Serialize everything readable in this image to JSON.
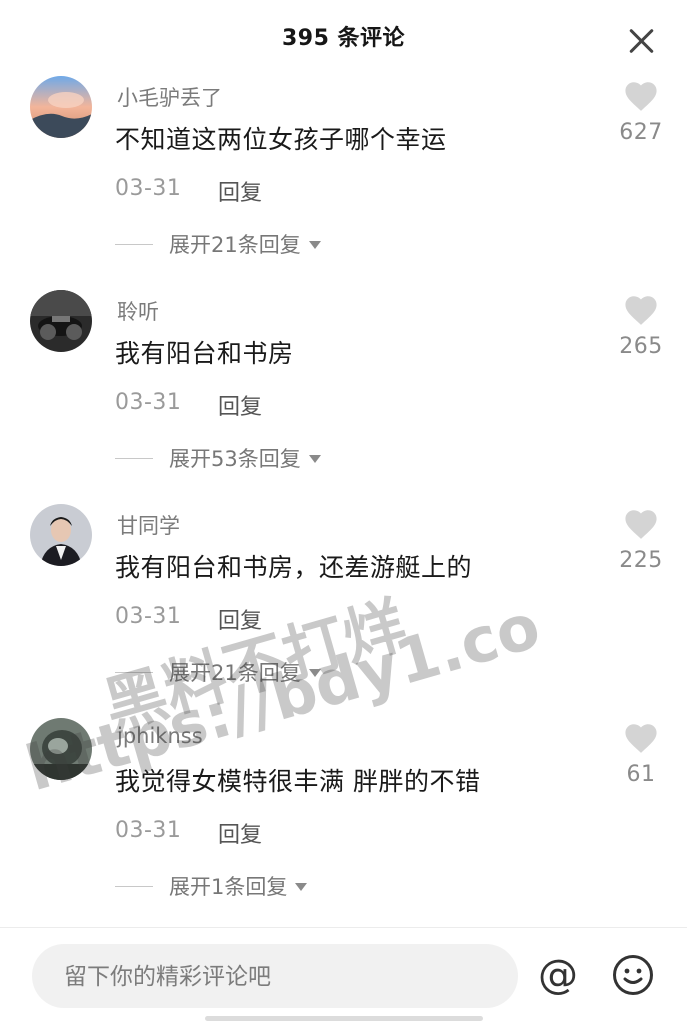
{
  "header": {
    "title": "395 条评论"
  },
  "comments": [
    {
      "username": "小毛驴丢了",
      "content": "不知道这两位女孩子哪个幸运",
      "date": "03-31",
      "reply_label": "回复",
      "expand_label": "展开21条回复",
      "likes": "627"
    },
    {
      "username": "聆听",
      "content": "我有阳台和书房",
      "date": "03-31",
      "reply_label": "回复",
      "expand_label": "展开53条回复",
      "likes": "265"
    },
    {
      "username": "甘同学",
      "content": "我有阳台和书房，还差游艇上的",
      "date": "03-31",
      "reply_label": "回复",
      "expand_label": "展开21条回复",
      "likes": "225"
    },
    {
      "username": "jphiknss",
      "content": "我觉得女模特很丰满 胖胖的不错",
      "date": "03-31",
      "reply_label": "回复",
      "expand_label": "展开1条回复",
      "likes": "61"
    }
  ],
  "watermark": {
    "line1": "黑料不打烊",
    "line2": "https://bdy1.co"
  },
  "footer": {
    "input_placeholder": "留下你的精彩评论吧",
    "at_symbol": "@"
  },
  "icons": {
    "close": "close-icon",
    "like": "heart-icon",
    "emoji": "smiley-icon",
    "expand": "caret-down-icon"
  },
  "colors": {
    "like_icon": "#d4d4d4",
    "muted_text": "#8a8a8a"
  }
}
